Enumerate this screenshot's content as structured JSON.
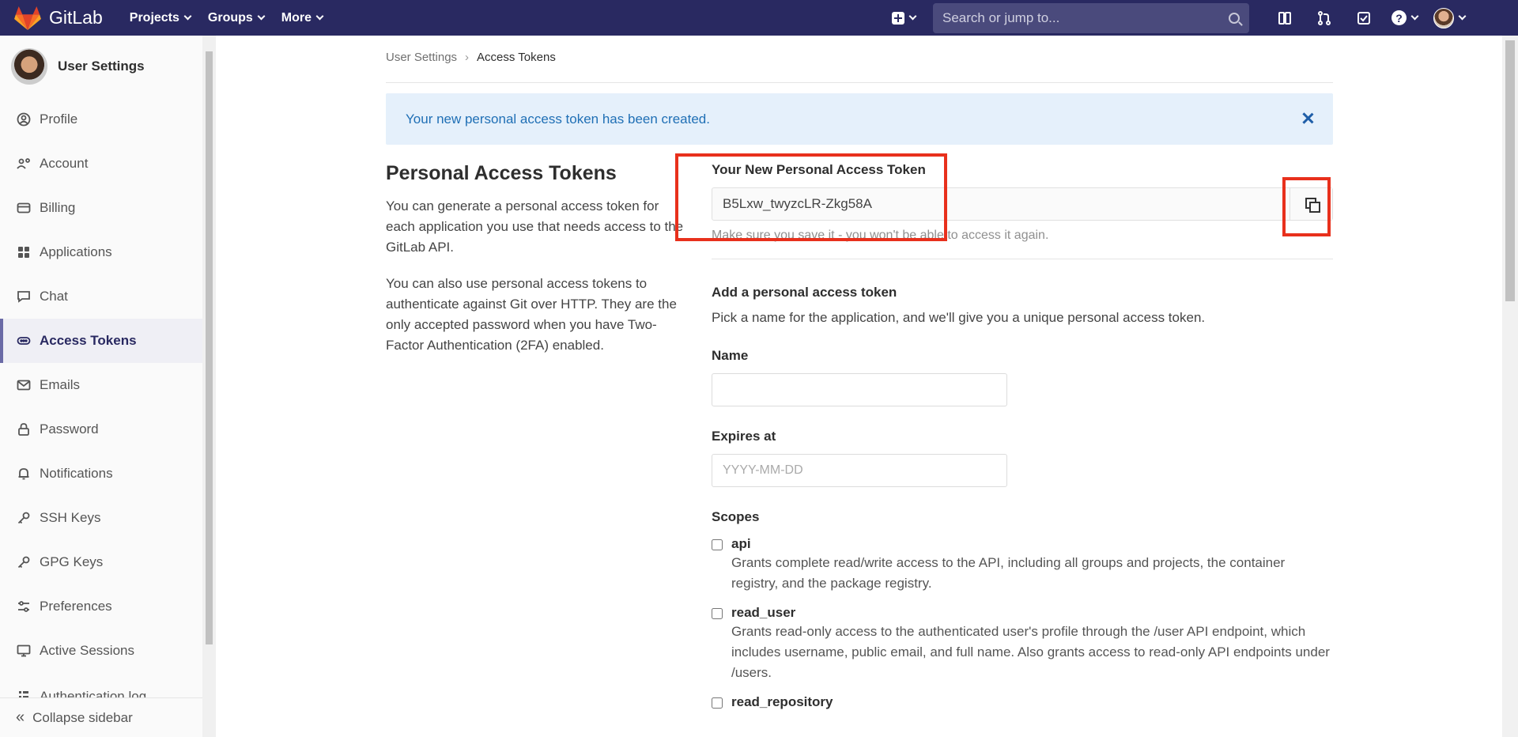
{
  "topbar": {
    "brand": "GitLab",
    "nav": [
      "Projects",
      "Groups",
      "More"
    ],
    "search_placeholder": "Search or jump to...",
    "help_glyph": "?"
  },
  "sidebar": {
    "title": "User Settings",
    "items": [
      {
        "label": "Profile",
        "icon": "profile-icon"
      },
      {
        "label": "Account",
        "icon": "account-icon"
      },
      {
        "label": "Billing",
        "icon": "billing-icon"
      },
      {
        "label": "Applications",
        "icon": "applications-icon"
      },
      {
        "label": "Chat",
        "icon": "chat-icon"
      },
      {
        "label": "Access Tokens",
        "icon": "token-icon",
        "active": true
      },
      {
        "label": "Emails",
        "icon": "mail-icon"
      },
      {
        "label": "Password",
        "icon": "lock-icon"
      },
      {
        "label": "Notifications",
        "icon": "bell-icon"
      },
      {
        "label": "SSH Keys",
        "icon": "key-icon"
      },
      {
        "label": "GPG Keys",
        "icon": "key-icon"
      },
      {
        "label": "Preferences",
        "icon": "settings-icon"
      },
      {
        "label": "Active Sessions",
        "icon": "monitor-icon"
      },
      {
        "label": "Authentication log",
        "icon": "log-icon"
      }
    ],
    "collapse_label": "Collapse sidebar"
  },
  "breadcrumb": {
    "root": "User Settings",
    "current": "Access Tokens"
  },
  "flash": {
    "message": "Your new personal access token has been created."
  },
  "intro": {
    "title": "Personal Access Tokens",
    "p1": "You can generate a personal access token for each application you use that needs access to the GitLab API.",
    "p2": "You can also use personal access tokens to authenticate against Git over HTTP. They are the only accepted password when you have Two-Factor Authentication (2FA) enabled."
  },
  "new_token": {
    "label": "Your New Personal Access Token",
    "value": "B5Lxw_twyzcLR-Zkg58A",
    "hint": "Make sure you save it - you won't be able to access it again."
  },
  "add_form": {
    "title": "Add a personal access token",
    "description": "Pick a name for the application, and we'll give you a unique personal access token.",
    "name_label": "Name",
    "name_value": "",
    "expires_label": "Expires at",
    "expires_placeholder": "YYYY-MM-DD",
    "scopes_label": "Scopes",
    "scopes": [
      {
        "name": "api",
        "desc": "Grants complete read/write access to the API, including all groups and projects, the container registry, and the package registry.",
        "checked": false
      },
      {
        "name": "read_user",
        "desc": "Grants read-only access to the authenticated user's profile through the /user API endpoint, which includes username, public email, and full name. Also grants access to read-only API endpoints under /users.",
        "checked": false
      },
      {
        "name": "read_repository",
        "desc": "",
        "checked": false
      }
    ]
  },
  "colors": {
    "navbar": "#292961",
    "flash_bg": "#e5f0fb",
    "flash_text": "#1f6fb5",
    "highlight": "#e8301c"
  }
}
